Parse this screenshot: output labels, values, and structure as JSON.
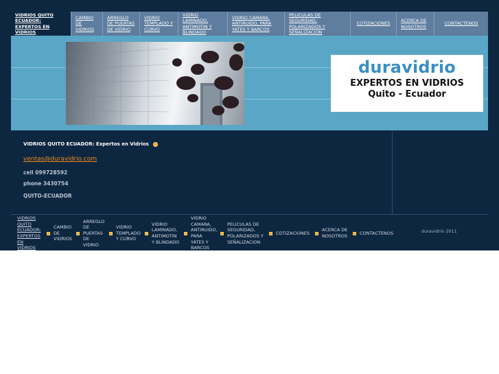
{
  "nav": {
    "items": [
      {
        "label": "VIDRIOS QUITO ECUADOR: Expertos en Vidrios"
      },
      {
        "label": "CAMBIO DE VIDRIOS"
      },
      {
        "label": "ARREGLO DE PUERTAS DE VIDRIO"
      },
      {
        "label": "VIDRIO TEMPLADO Y CURVO"
      },
      {
        "label": "VIDRIO LAMINADO, ANTIMOTIN Y BLINDADO"
      },
      {
        "label": "VIDRIO CAMARA, ANTIRUIDO, PARA YATES Y BARCOS"
      },
      {
        "label": "PELICULAS DE SEGURIDAD, POLARIZADOS Y SEÑALIZACION"
      },
      {
        "label": "COTIZACIONES"
      },
      {
        "label": "ACERCA DE NOSOTROS"
      },
      {
        "label": "CONTACTENOS"
      }
    ]
  },
  "logo": {
    "brand": "duravidrio",
    "line1": "EXPERTOS EN VIDRIOS",
    "line2": "Quito - Ecuador"
  },
  "main": {
    "headline": "VIDRIOS QUITO ECUADOR: Expertos en Vidrios",
    "email": "ventas@duravidrio.com",
    "cell": "cell  099728592",
    "phone": "phone 3430754",
    "city": "QUITO-ECUADOR"
  },
  "footer": {
    "copyright": "duravidrio 2011"
  },
  "colors": {
    "background": "#0e2741",
    "nav": "#5f7d9e",
    "banner": "#5aa6c6",
    "accent": "#f08a1c",
    "brand": "#3a8fc2"
  }
}
